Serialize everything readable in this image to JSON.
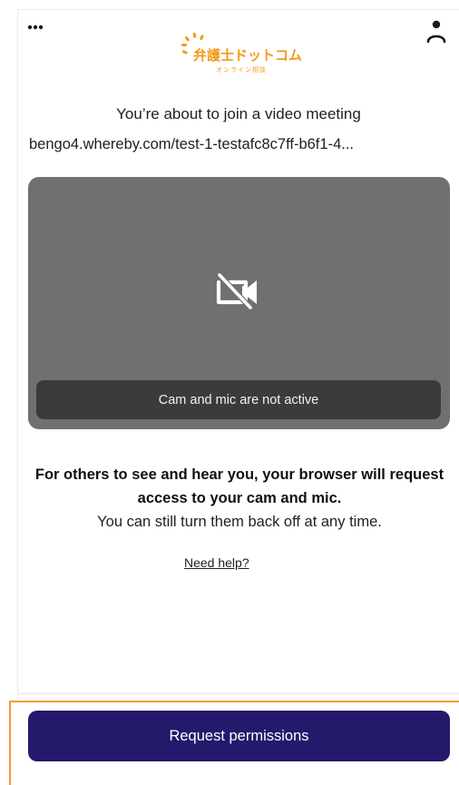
{
  "header": {
    "menu_icon": "more-horizontal-icon",
    "user_icon": "person-icon",
    "logo": {
      "main_text": "弁護士ドットコム",
      "sub_text": "オンライン相談",
      "color": "#f39a1b"
    }
  },
  "join": {
    "title": "You’re about to join a video meeting",
    "url": "bengo4.whereby.com/test-1-testafc8c7ff-b6f1-4..."
  },
  "preview": {
    "icon": "camera-off-icon",
    "status": "Cam and mic are not active",
    "background_color": "#707070"
  },
  "info": {
    "bold_text": "For others to see and hear you, your browser will request access to your cam and mic.",
    "plain_text": "You can still turn them back off at any time."
  },
  "help": {
    "link_text": "Need help?"
  },
  "footer": {
    "button_label": "Request permissions",
    "button_color": "#241a6b",
    "highlight_color": "#f19a33"
  }
}
